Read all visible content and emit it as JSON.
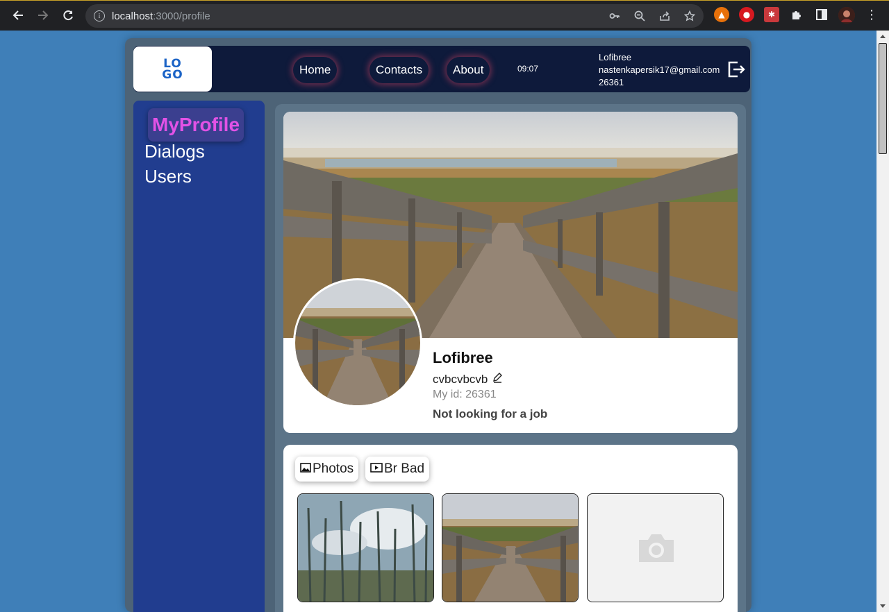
{
  "browser": {
    "url_host": "localhost",
    "url_path": ":3000/profile"
  },
  "header": {
    "logo_line1": "LO",
    "logo_line2": "GO",
    "nav": [
      "Home",
      "Contacts",
      "About"
    ],
    "time": "09:07",
    "user_name": "Lofibree",
    "user_email": "nastenkapersik17@gmail.com",
    "user_id": "26361"
  },
  "sidebar": {
    "items": [
      "MyProfile",
      "Dialogs",
      "Users"
    ]
  },
  "profile": {
    "name": "Lofibree",
    "status": "cvbcvbcvb",
    "id_text": "My id: 26361",
    "job": "Not looking for a job"
  },
  "gallery": {
    "tabs": [
      "Photos",
      "Br Bad"
    ]
  },
  "colors": {
    "page_bg": "#3f7fb8",
    "header_bg": "#0e1a3b",
    "sidebar_bg": "#213d8f",
    "active_text": "#e252e6"
  }
}
